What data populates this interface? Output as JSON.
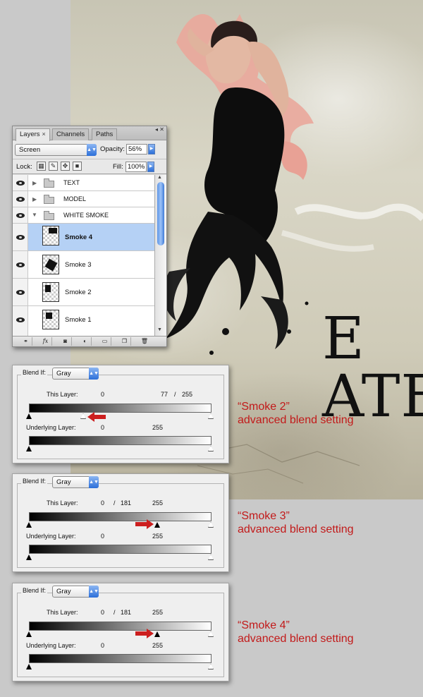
{
  "artwork": {
    "title_text": "E  ATE"
  },
  "layers_panel": {
    "tabs": [
      {
        "label": "Layers",
        "close": "×"
      },
      {
        "label": "Channels"
      },
      {
        "label": "Paths"
      }
    ],
    "window_buttons": "◂ ✕",
    "blend_mode": "Screen",
    "opacity_label": "Opacity:",
    "opacity_value": "56%",
    "lock_label": "Lock:",
    "fill_label": "Fill:",
    "fill_value": "100%",
    "groups": [
      {
        "name": "TEXT",
        "expanded": false
      },
      {
        "name": "MODEL",
        "expanded": false
      },
      {
        "name": "WHITE SMOKE",
        "expanded": true
      }
    ],
    "layers": [
      {
        "name": "Smoke 4",
        "selected": true
      },
      {
        "name": "Smoke 3",
        "selected": false
      },
      {
        "name": "Smoke 2",
        "selected": false
      },
      {
        "name": "Smoke 1",
        "selected": false
      }
    ],
    "bottom_icons": [
      "link-icon",
      "fx-icon",
      "mask-icon",
      "adjustment-icon",
      "folder-icon",
      "new-layer-icon",
      "trash-icon"
    ],
    "fx_label": "fx"
  },
  "blend_panels": [
    {
      "blend_if_label": "Blend If:",
      "channel": "Gray",
      "this_layer_label": "This Layer:",
      "this_layer_values": {
        "a": "0",
        "b": "77",
        "sep": "/",
        "c": "255"
      },
      "underlying_label": "Underlying Layer:",
      "underlying_values": {
        "a": "0",
        "c": "255"
      },
      "caption_line1": "“Smoke 2”",
      "caption_line2": "advanced blend setting"
    },
    {
      "blend_if_label": "Blend If:",
      "channel": "Gray",
      "this_layer_label": "This Layer:",
      "this_layer_values": {
        "a": "0",
        "sep": "/",
        "b": "181",
        "c": "255"
      },
      "underlying_label": "Underlying Layer:",
      "underlying_values": {
        "a": "0",
        "c": "255"
      },
      "caption_line1": "“Smoke 3”",
      "caption_line2": "advanced blend setting"
    },
    {
      "blend_if_label": "Blend If:",
      "channel": "Gray",
      "this_layer_label": "This Layer:",
      "this_layer_values": {
        "a": "0",
        "sep": "/",
        "b": "181",
        "c": "255"
      },
      "underlying_label": "Underlying Layer:",
      "underlying_values": {
        "a": "0",
        "c": "255"
      },
      "caption_line1": "“Smoke 4”",
      "caption_line2": "advanced blend setting"
    }
  ],
  "colors": {
    "caption_red": "#c21a1a",
    "selection_blue": "#b5d1f5",
    "arrow_red": "#cc1f1f"
  }
}
